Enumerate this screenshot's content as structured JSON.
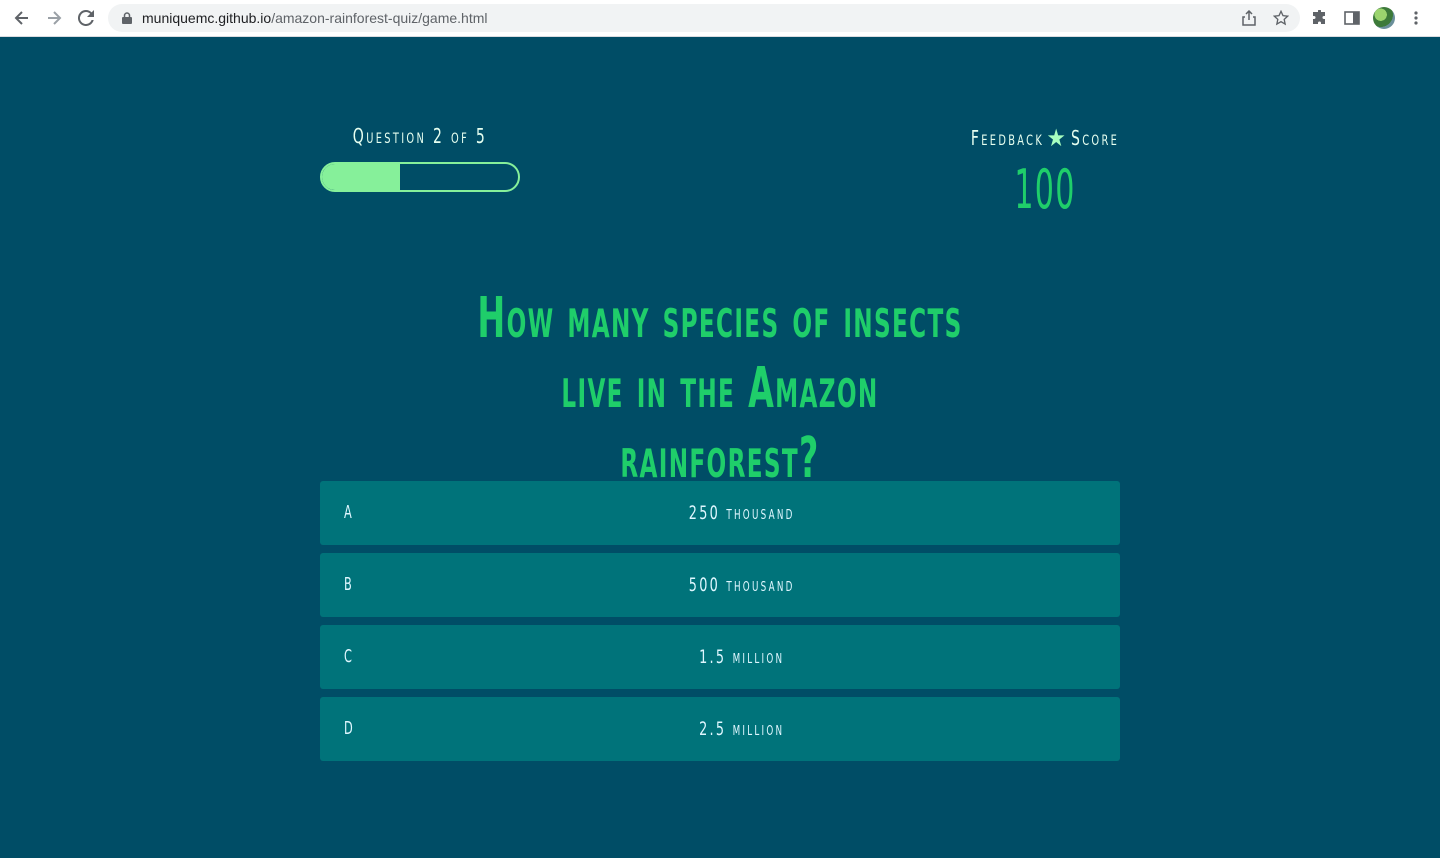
{
  "browser": {
    "url_domain": "muniquemc.github.io",
    "url_path": "/amazon-rainforest-quiz/game.html",
    "icons": {
      "back": "back-arrow-icon",
      "forward": "forward-arrow-icon",
      "reload": "reload-icon",
      "lock": "lock-icon",
      "share": "share-icon",
      "bookmark": "star-outline-icon",
      "extensions": "puzzle-icon",
      "sidepanel": "side-panel-icon",
      "menu": "kebab-menu-icon"
    }
  },
  "hud": {
    "question_progress_text": "Question 2 of 5",
    "progress_fraction": 0.4,
    "feedback_label": "Feedback",
    "score_label": "Score",
    "score_value": "100"
  },
  "question": {
    "text": "How many species of insects live in the Amazon rainforest?"
  },
  "answers": [
    {
      "letter": "A",
      "text": "250 thousand"
    },
    {
      "letter": "B",
      "text": "500 thousand"
    },
    {
      "letter": "C",
      "text": "1.5 million"
    },
    {
      "letter": "D",
      "text": "2.5 million"
    }
  ],
  "colors": {
    "background": "#004d66",
    "accent_green": "#1fce6a",
    "progress_green": "#86f09a",
    "answer_bg": "#00737a"
  }
}
